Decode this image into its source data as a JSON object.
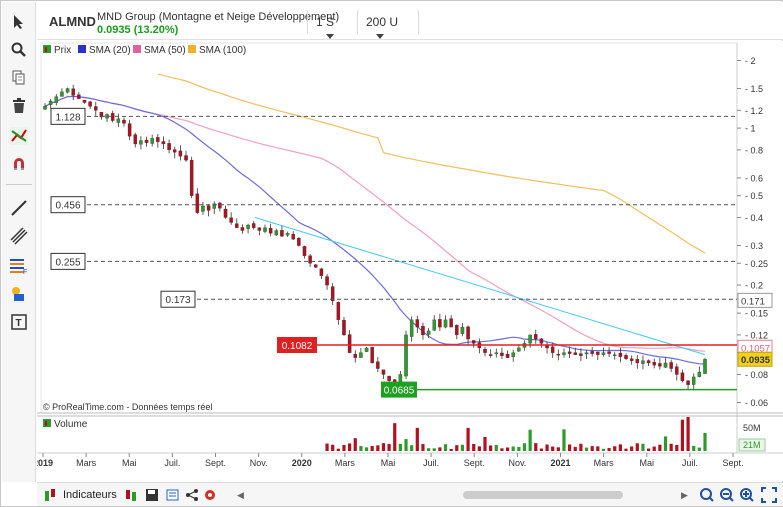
{
  "header": {
    "symbol": "ALMND",
    "name": "MND Group (Montagne et Neige Développement)",
    "price": "0.0935 (13.20%)",
    "interval": "1 S",
    "bars": "200 U"
  },
  "legend": {
    "price": "Prix",
    "sma20": "SMA (20)",
    "sma50": "SMA (50)",
    "sma100": "SMA (100)",
    "volume": "Volume"
  },
  "watermark": "© ProRealTime.com - Données temps réel",
  "bottom": {
    "indicators": "Indicateurs"
  },
  "colors": {
    "up": "#2e9a2e",
    "down": "#b01020",
    "sma20": "#6c6cdc",
    "sma50": "#f0a0c0",
    "sma100": "#f0c060",
    "trend": "#40c8f0",
    "resistance": "#e02020",
    "support": "#20a020"
  },
  "chart_data": {
    "type": "candlestick",
    "y_scale": "log",
    "ylim": [
      0.055,
      2.25
    ],
    "y_ticks": [
      "2",
      "1.5",
      "1.2",
      "1",
      "0.8",
      "0.6",
      "0.5",
      "0.4",
      "0.3",
      "0.25",
      "0.2",
      "0.15",
      "0.12",
      "0.1",
      "0.08",
      "0.06"
    ],
    "x_ticks": [
      "2019",
      "Mars",
      "Mai",
      "Juil.",
      "Sept.",
      "Nov.",
      "2020",
      "Mars",
      "Mai",
      "Juil.",
      "Sept.",
      "Nov.",
      "2021",
      "Mars",
      "Mai",
      "Juil.",
      "Sept."
    ],
    "horizontal_levels": [
      {
        "label": "1.128",
        "value": 1.128
      },
      {
        "label": "0.456",
        "value": 0.456
      },
      {
        "label": "0.255",
        "value": 0.255
      },
      {
        "label": "0.173",
        "value": 0.173
      }
    ],
    "resistance": {
      "label": "0.1082",
      "value": 0.1082
    },
    "support": {
      "label": "0.0685",
      "value": 0.0685
    },
    "right_tags": [
      {
        "label": "0.171",
        "value": 0.171
      },
      {
        "label": "0.1057",
        "value": 0.1057
      },
      {
        "label": "0.0935",
        "value": 0.0935
      }
    ],
    "closes": [
      1.25,
      1.32,
      1.38,
      1.45,
      1.5,
      1.4,
      1.35,
      1.3,
      1.25,
      1.2,
      1.12,
      1.15,
      1.08,
      1.1,
      1.05,
      0.92,
      0.85,
      0.88,
      0.86,
      0.9,
      0.87,
      0.85,
      0.8,
      0.78,
      0.75,
      0.72,
      0.5,
      0.42,
      0.45,
      0.43,
      0.46,
      0.44,
      0.4,
      0.38,
      0.36,
      0.35,
      0.37,
      0.36,
      0.35,
      0.36,
      0.34,
      0.35,
      0.33,
      0.34,
      0.32,
      0.3,
      0.27,
      0.25,
      0.24,
      0.22,
      0.2,
      0.17,
      0.14,
      0.12,
      0.1,
      0.095,
      0.1,
      0.105,
      0.09,
      0.085,
      0.08,
      0.075,
      0.072,
      0.08,
      0.12,
      0.14,
      0.13,
      0.12,
      0.125,
      0.14,
      0.13,
      0.14,
      0.13,
      0.12,
      0.13,
      0.115,
      0.11,
      0.105,
      0.1,
      0.098,
      0.1,
      0.097,
      0.095,
      0.1,
      0.105,
      0.11,
      0.12,
      0.115,
      0.11,
      0.105,
      0.1,
      0.098,
      0.1,
      0.099,
      0.098,
      0.097,
      0.1,
      0.099,
      0.098,
      0.1,
      0.099,
      0.098,
      0.096,
      0.094,
      0.092,
      0.09,
      0.092,
      0.09,
      0.088,
      0.087,
      0.09,
      0.085,
      0.08,
      0.075,
      0.072,
      0.078,
      0.082,
      0.0935
    ],
    "volume_ticks": [
      "50M",
      "21M"
    ]
  }
}
